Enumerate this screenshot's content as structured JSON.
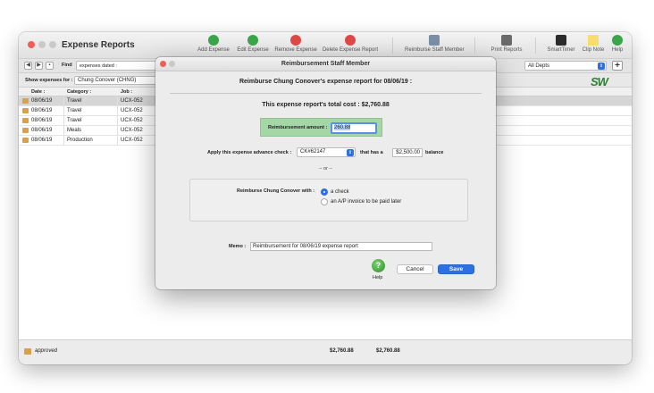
{
  "window": {
    "title": "Expense Reports"
  },
  "toolbar": {
    "add_expense": "Add Expense",
    "edit_expense": "Edit Expense",
    "remove_expense": "Remove Expense",
    "delete_expense_report": "Delete Expense Report",
    "reimburse_staff_member": "Reimburse Staff Member",
    "print_reports": "Print Reports",
    "smarttimer": "SmartTimer",
    "clip_note": "Clip Note",
    "help": "Help"
  },
  "findbar": {
    "label": "Find",
    "selector": "expenses dated :",
    "dept": "All Depts"
  },
  "showbar": {
    "label": "Show expenses for :",
    "staff": "Chung Conover (CHNG)",
    "logo": "SW"
  },
  "table": {
    "columns": [
      "Date :",
      "Category :",
      "Job :"
    ],
    "rows": [
      {
        "date": "08/06/19",
        "category": "Travel",
        "job": "UCX-052"
      },
      {
        "date": "08/06/19",
        "category": "Travel",
        "job": "UCX-052"
      },
      {
        "date": "08/06/19",
        "category": "Travel",
        "job": "UCX-052"
      },
      {
        "date": "08/06/19",
        "category": "Meals",
        "job": "UCX-052"
      },
      {
        "date": "08/06/19",
        "category": "Production",
        "job": "UCX-052"
      }
    ]
  },
  "footer": {
    "status": "approved",
    "total1": "$2,760.88",
    "total2": "$2,760.88"
  },
  "dialog": {
    "title": "Reimbursement Staff Member",
    "heading": "Reimburse Chung Conover's expense report for 08/06/19 :",
    "total_cost": "This expense report's total cost :  $2,760.88",
    "reimbursement_label": "Reimbursement amount :",
    "reimbursement_value": "260.88",
    "advance_label": "Apply this expense advance check :",
    "advance_check": "CK#62147",
    "has_a": "that has a",
    "advance_amount": "$2,500.00",
    "balance": "balance",
    "or": "-- or --",
    "reimburse_with_label": "Reimburse Chung Conover with :",
    "option_check": "a check",
    "option_invoice": "an A/P invoice to be paid later",
    "memo_label": "Memo :",
    "memo_value": "Reimbursement for 08/06/19 expense report",
    "help_label": "Help",
    "cancel_label": "Cancel",
    "save_label": "Save"
  },
  "colors": {
    "accent": "#2f6fe0",
    "highlight": "#a5d6a7"
  }
}
